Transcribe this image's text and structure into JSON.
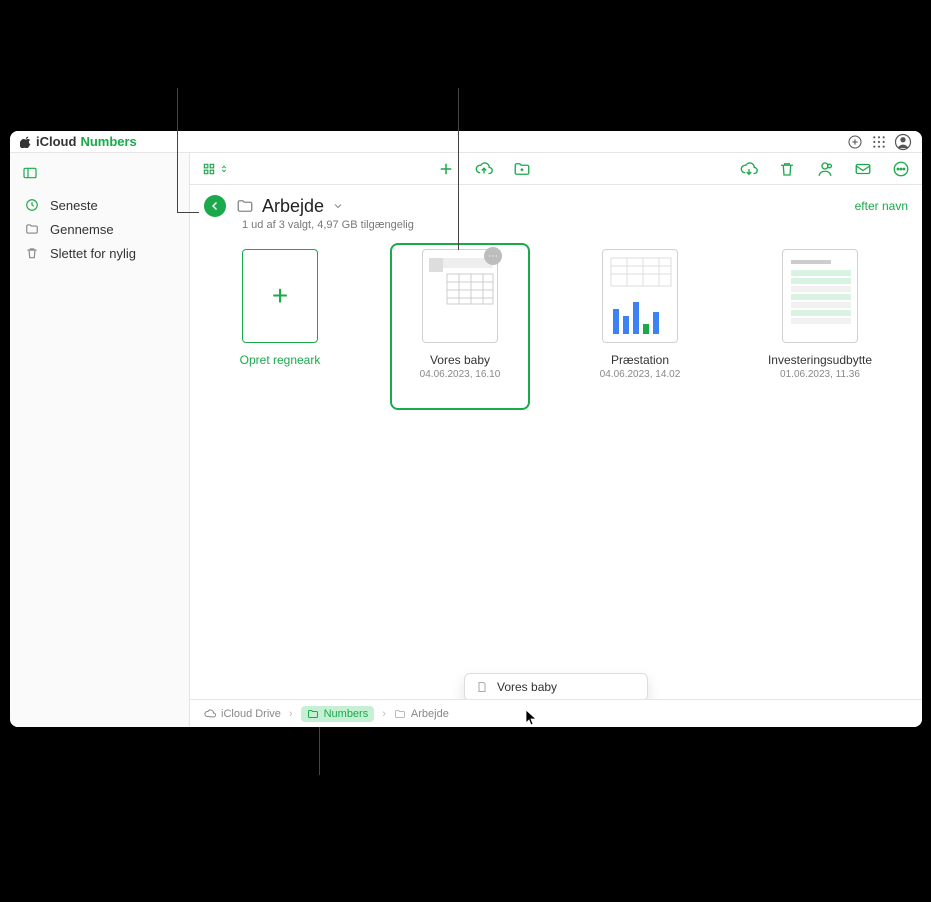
{
  "titlebar": {
    "cloud_word": "iCloud",
    "app_word": "Numbers"
  },
  "sidebar": {
    "items": [
      {
        "label": "Seneste",
        "icon": "clock"
      },
      {
        "label": "Gennemse",
        "icon": "folder"
      },
      {
        "label": "Slettet for nylig",
        "icon": "trash"
      }
    ]
  },
  "header": {
    "folder_name": "Arbejde",
    "subtitle": "1 ud af 3 valgt, 4,97 GB tilgængelig",
    "sort_label": "efter navn"
  },
  "tiles": {
    "new_label": "Opret regneark",
    "items": [
      {
        "name": "Vores baby",
        "ts": "04.06.2023, 16.10",
        "selected": true
      },
      {
        "name": "Præstation",
        "ts": "04.06.2023, 14.02",
        "selected": false
      },
      {
        "name": "Investeringsudbytte",
        "ts": "01.06.2023, 11.36",
        "selected": false
      }
    ]
  },
  "drag_ghost": {
    "label": "Vores baby"
  },
  "breadcrumb": {
    "items": [
      {
        "label": "iCloud Drive",
        "icon": "cloud",
        "hover": false
      },
      {
        "label": "Numbers",
        "icon": "folder",
        "hover": true
      },
      {
        "label": "Arbejde",
        "icon": "folder",
        "hover": false
      }
    ]
  }
}
